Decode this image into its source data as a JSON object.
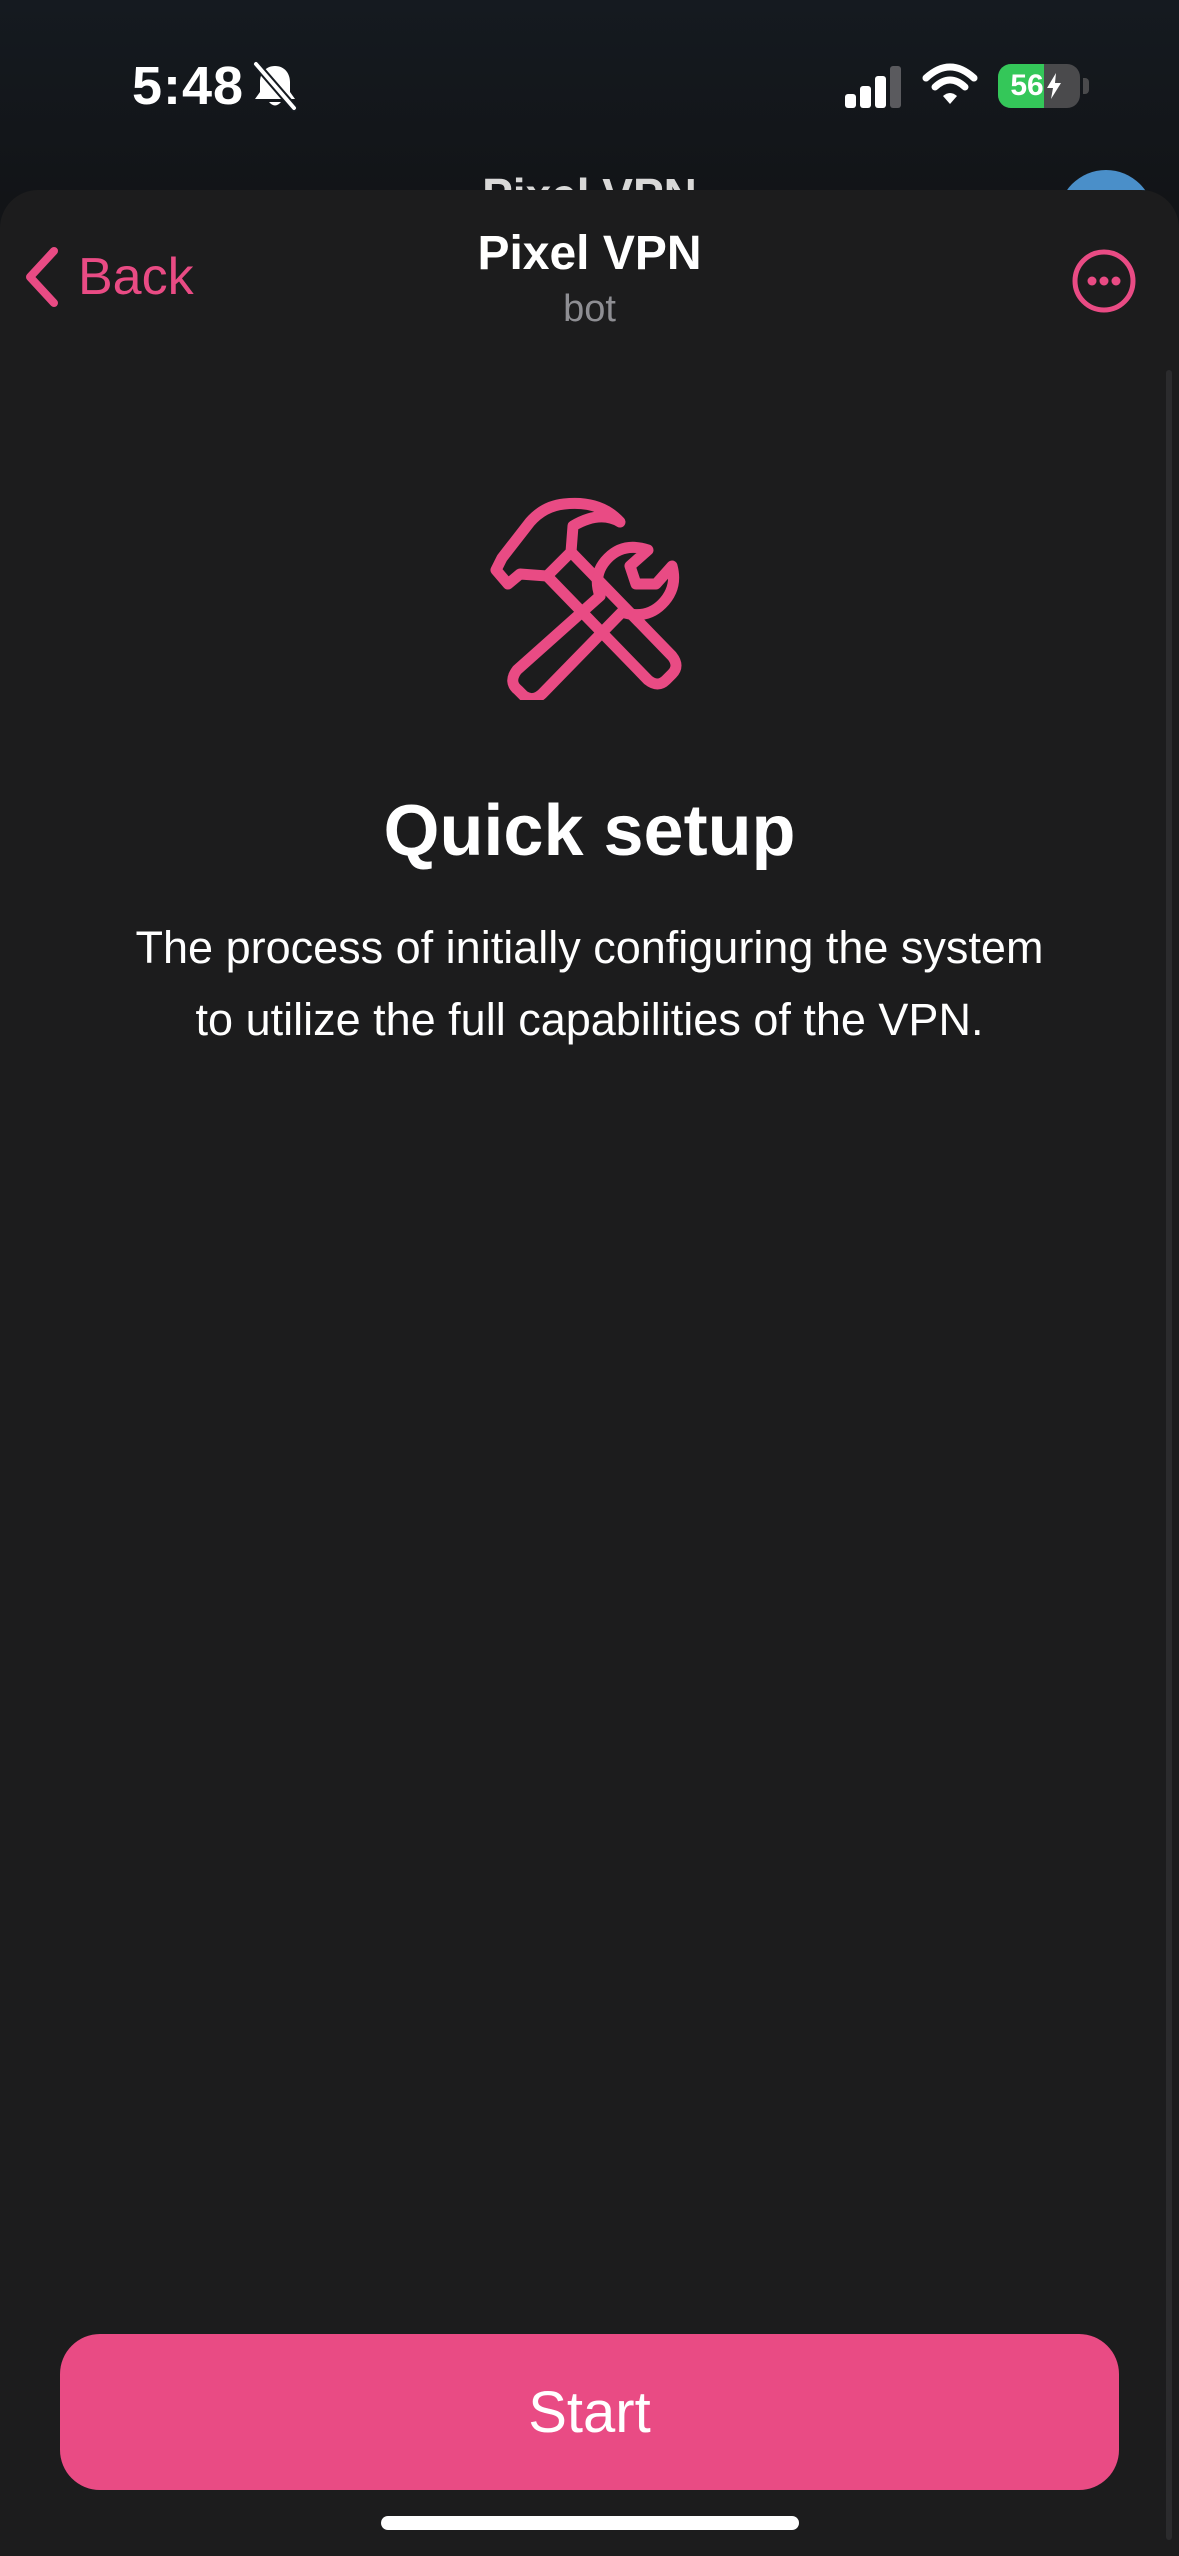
{
  "status_bar": {
    "time": "5:48",
    "battery_level": 56,
    "battery_text": "56",
    "icons": [
      "bell-slash-icon",
      "cellular-signal-icon",
      "wifi-icon",
      "battery-charging-icon"
    ]
  },
  "background_chat": {
    "title": "Pixel VPN"
  },
  "nav": {
    "back_label": "Back",
    "title": "Pixel VPN",
    "subtitle": "bot",
    "more_icon": "ellipsis-circle-icon"
  },
  "content": {
    "hero_icon": "hammer-wrench-icon",
    "heading": "Quick setup",
    "description": "The process of initially configuring the system to utilize the full capabilities of the VPN."
  },
  "actions": {
    "start_label": "Start"
  },
  "colors": {
    "accent": "#e94b84",
    "sheet_background": "#1c1c1d",
    "battery_green": "#34c759"
  }
}
